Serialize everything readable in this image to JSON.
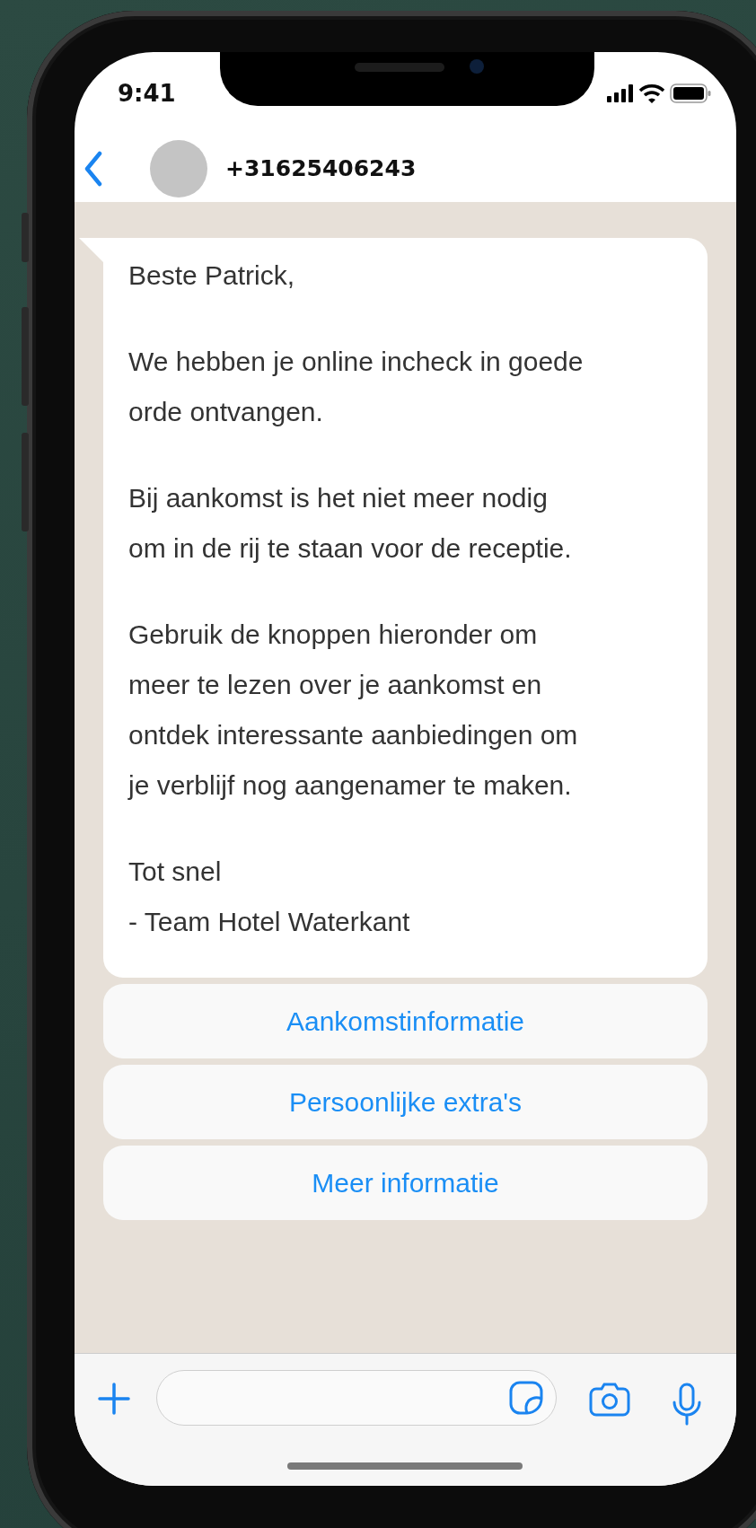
{
  "status_bar": {
    "time": "9:41"
  },
  "header": {
    "contact": "+31625406243"
  },
  "message": {
    "paragraphs": [
      [
        "Beste Patrick,"
      ],
      [
        "We hebben je online incheck in goede",
        "orde ontvangen."
      ],
      [
        "Bij aankomst is het niet meer nodig",
        "om in de rij te staan voor de receptie."
      ],
      [
        "Gebruik de knoppen hieronder om",
        "meer te lezen over je aankomst en",
        "ontdek interessante aanbiedingen om",
        "je verblijf nog aangenamer te maken."
      ],
      [
        "Tot snel",
        "- Team Hotel Waterkant"
      ]
    ]
  },
  "quick_replies": [
    "Aankomstinformatie",
    "Persoonlijke extra's",
    "Meer informatie"
  ]
}
